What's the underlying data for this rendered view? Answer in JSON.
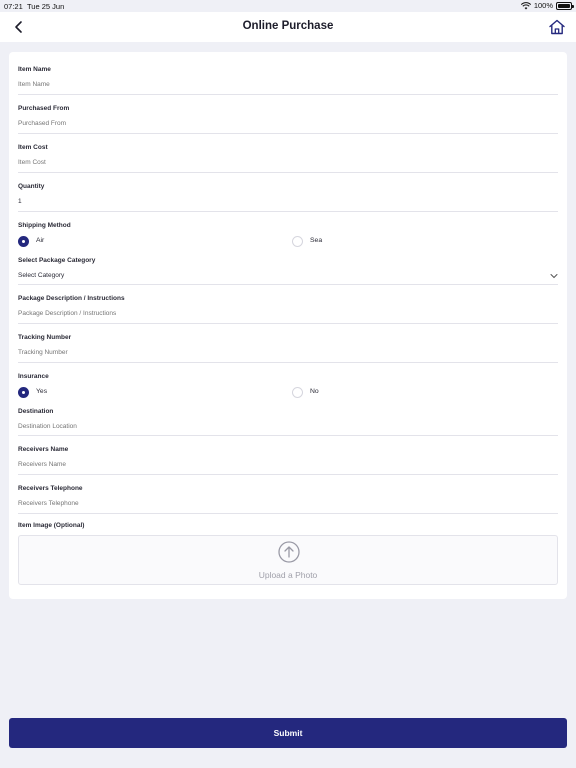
{
  "status_bar": {
    "time": "07:21",
    "date": "Tue 25 Jun",
    "battery": "100%"
  },
  "nav": {
    "title": "Online Purchase"
  },
  "form": {
    "item_name": {
      "label": "Item Name",
      "placeholder": "Item Name"
    },
    "purchased_from": {
      "label": "Purchased From",
      "placeholder": "Purchased From"
    },
    "item_cost": {
      "label": "Item Cost",
      "placeholder": "Item Cost"
    },
    "quantity": {
      "label": "Quantity",
      "value": "1"
    },
    "shipping_method": {
      "label": "Shipping Method",
      "options": [
        {
          "label": "Air",
          "checked": true
        },
        {
          "label": "Sea",
          "checked": false
        }
      ]
    },
    "package_category": {
      "label": "Select Package Category",
      "value": "Select Category"
    },
    "package_description": {
      "label": "Package Description / Instructions",
      "placeholder": "Package Description / Instructions"
    },
    "tracking_number": {
      "label": "Tracking Number",
      "placeholder": "Tracking Number"
    },
    "insurance": {
      "label": "Insurance",
      "options": [
        {
          "label": "Yes",
          "checked": true
        },
        {
          "label": "No",
          "checked": false
        }
      ]
    },
    "destination": {
      "label": "Destination",
      "placeholder": "Destination Location"
    },
    "receivers_name": {
      "label": "Receivers Name",
      "placeholder": "Receivers Name"
    },
    "receivers_telephone": {
      "label": "Receivers Telephone",
      "placeholder": "Receivers Telephone"
    },
    "item_image": {
      "label": "Item Image (Optional)",
      "upload_text": "Upload a Photo"
    }
  },
  "submit": {
    "label": "Submit"
  },
  "colors": {
    "primary": "#24287e",
    "background": "#eff0f6",
    "card": "#ffffff",
    "placeholder": "#9a9aa6"
  },
  "icons": {
    "back": "chevron-left-icon",
    "home": "home-icon",
    "wifi": "wifi-icon",
    "battery": "battery-icon",
    "upload": "arrow-up-circle-icon",
    "dropdown": "chevron-down-icon"
  }
}
